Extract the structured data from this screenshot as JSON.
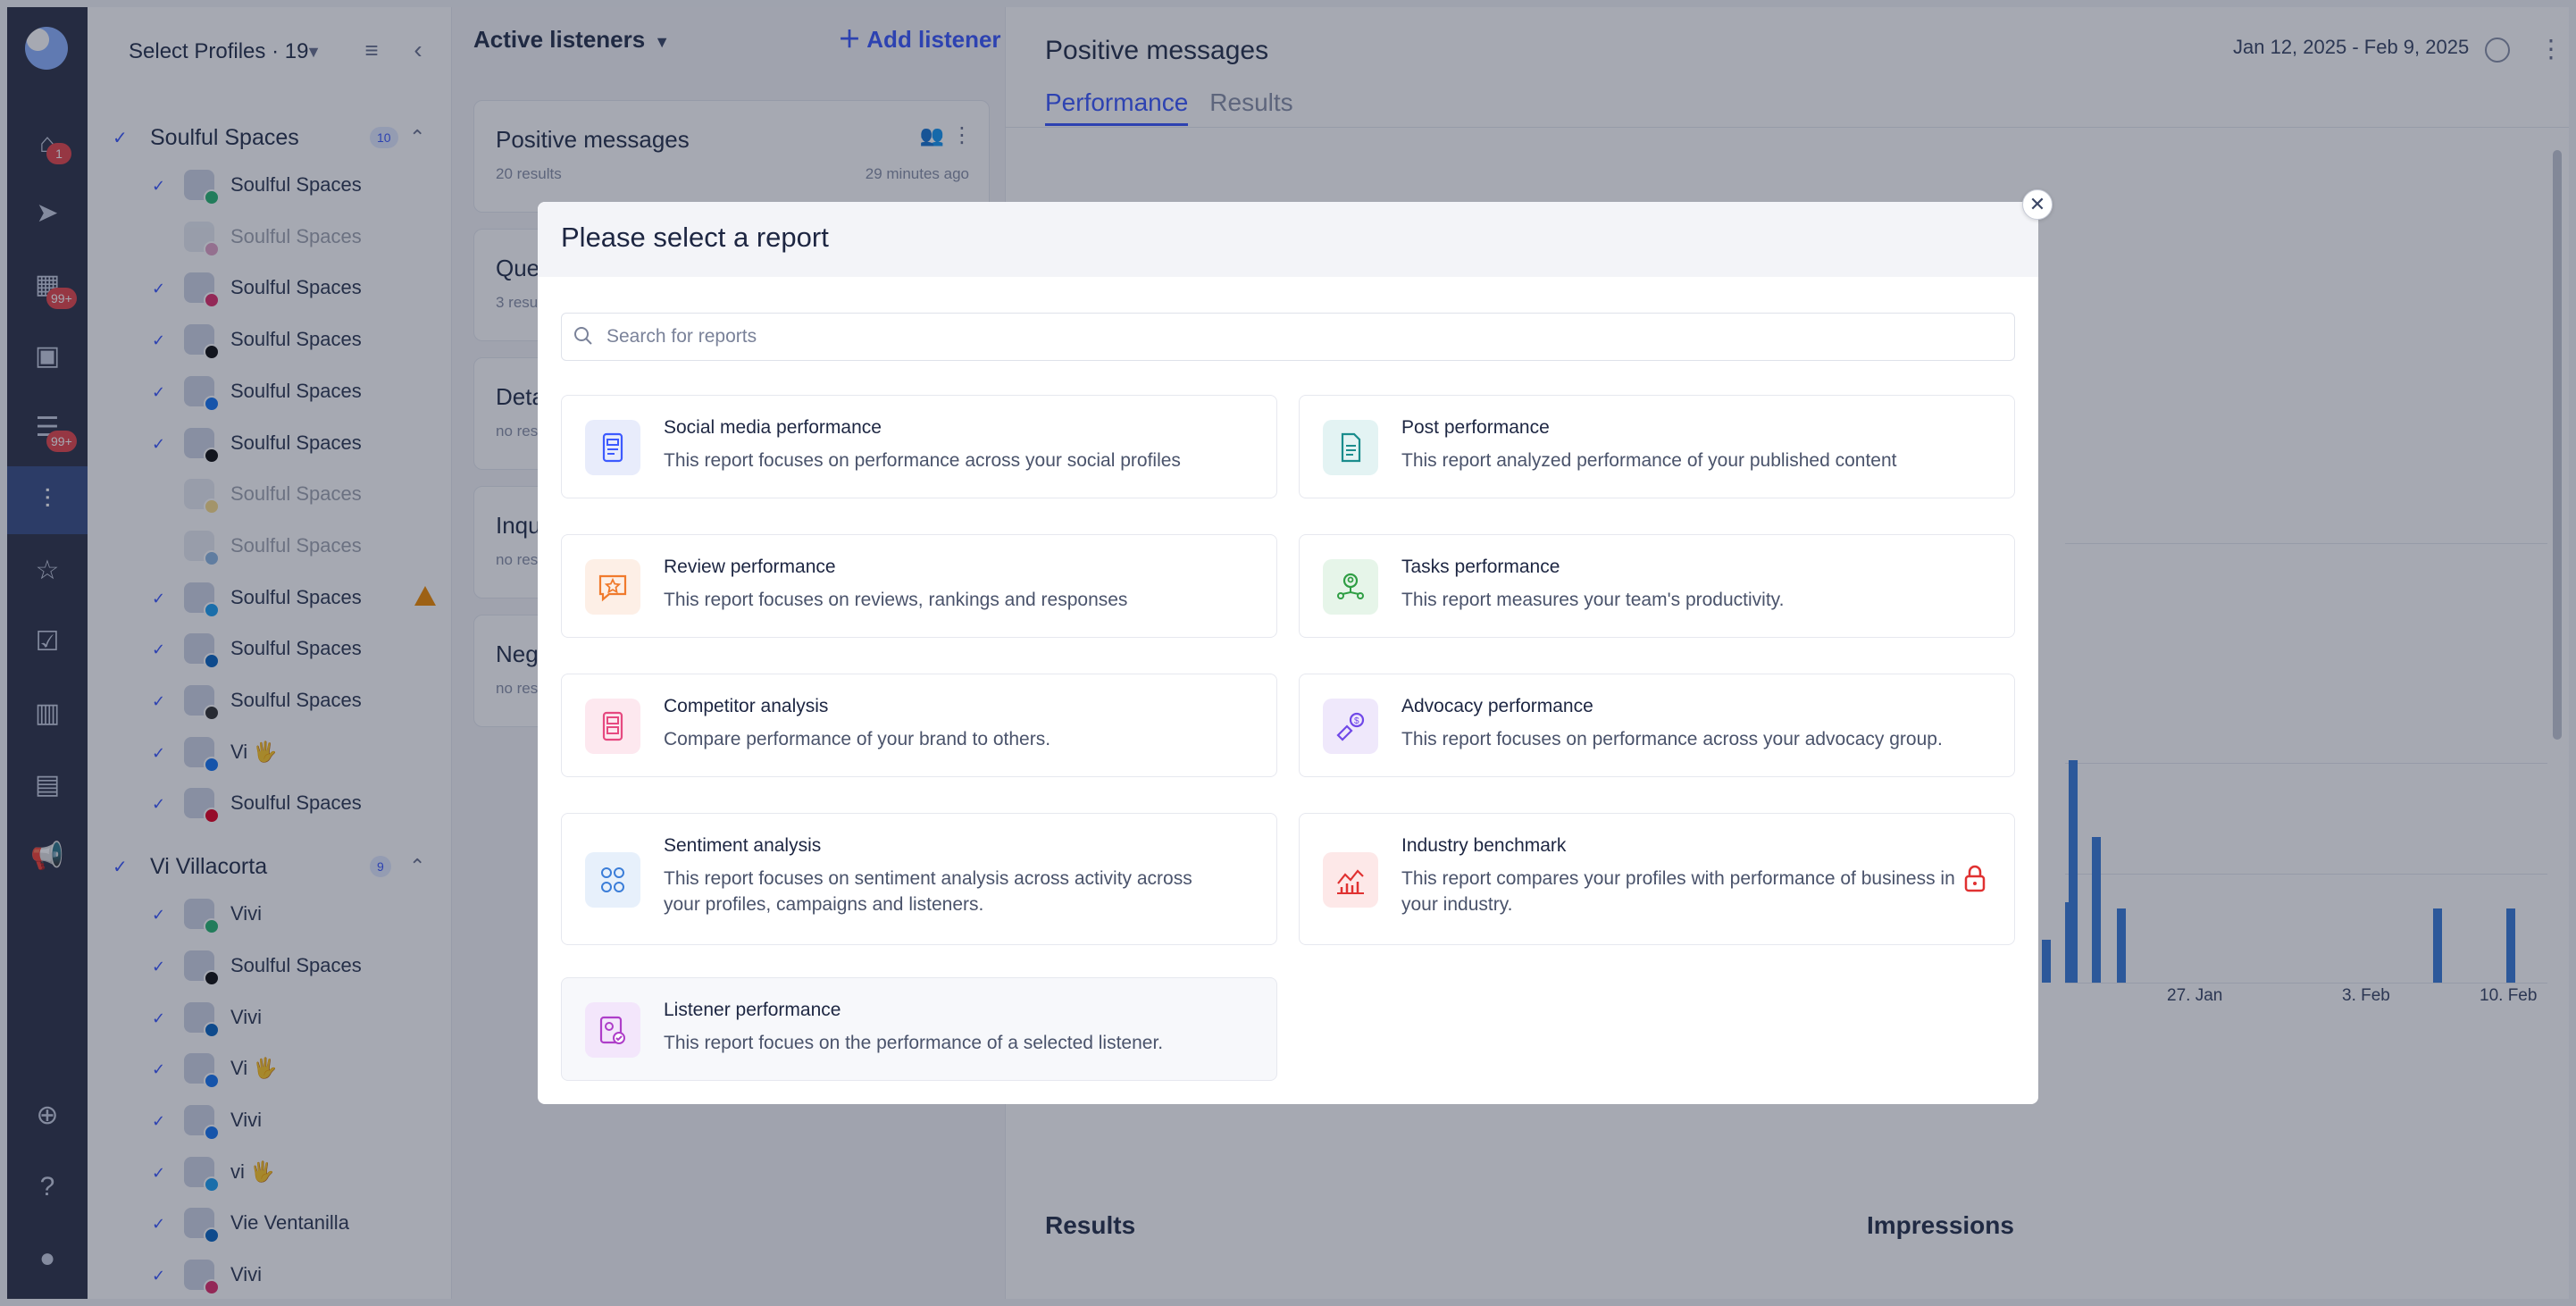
{
  "profiles_panel": {
    "select_label": "Select Profiles · 19",
    "groups": [
      {
        "name": "Soulful Spaces",
        "count": "10",
        "items": [
          {
            "name": "Soulful Spaces",
            "checked": true,
            "dim": false,
            "net_color": "#2bb673"
          },
          {
            "name": "Soulful Spaces",
            "checked": false,
            "dim": true,
            "net_color": "#c13584"
          },
          {
            "name": "Soulful Spaces",
            "checked": true,
            "dim": false,
            "net_color": "#e1306c"
          },
          {
            "name": "Soulful Spaces",
            "checked": true,
            "dim": false,
            "net_color": "#111111"
          },
          {
            "name": "Soulful Spaces",
            "checked": true,
            "dim": false,
            "net_color": "#1877f2"
          },
          {
            "name": "Soulful Spaces",
            "checked": true,
            "dim": false,
            "net_color": "#111111"
          },
          {
            "name": "Soulful Spaces",
            "checked": false,
            "dim": true,
            "net_color": "#f5b800"
          },
          {
            "name": "Soulful Spaces",
            "checked": false,
            "dim": true,
            "net_color": "#0a66c2"
          },
          {
            "name": "Soulful Spaces",
            "checked": true,
            "dim": false,
            "net_color": "#1da1f2",
            "warning": true
          },
          {
            "name": "Soulful Spaces",
            "checked": true,
            "dim": false,
            "net_color": "#0a66c2"
          },
          {
            "name": "Soulful Spaces",
            "checked": true,
            "dim": false,
            "net_color": "#333333"
          },
          {
            "name": "Vi 🖐",
            "checked": true,
            "dim": false,
            "net_color": "#1877f2"
          },
          {
            "name": "Soulful Spaces",
            "checked": true,
            "dim": false,
            "net_color": "#e60023"
          }
        ]
      },
      {
        "name": "Vi Villacorta",
        "count": "9",
        "items": [
          {
            "name": "Vivi",
            "checked": true,
            "dim": false,
            "net_color": "#2bb673"
          },
          {
            "name": "Soulful Spaces",
            "checked": true,
            "dim": false,
            "net_color": "#111111"
          },
          {
            "name": "Vivi",
            "checked": true,
            "dim": false,
            "net_color": "#0a66c2"
          },
          {
            "name": "Vi 🖐",
            "checked": true,
            "dim": false,
            "net_color": "#1877f2"
          },
          {
            "name": "Vivi",
            "checked": true,
            "dim": false,
            "net_color": "#1877f2"
          },
          {
            "name": "vi 🖐",
            "checked": true,
            "dim": false,
            "net_color": "#1da1f2"
          },
          {
            "name": "Vie Ventanilla",
            "checked": true,
            "dim": false,
            "net_color": "#0a66c2"
          },
          {
            "name": "Vivi",
            "checked": true,
            "dim": false,
            "net_color": "#e1306c"
          }
        ]
      }
    ]
  },
  "listeners_panel": {
    "header": "Active listeners",
    "add_label": "Add listener",
    "cards": [
      {
        "title": "Positive messages",
        "subtitle": "20 results",
        "time": "29 minutes ago"
      },
      {
        "title": "Quer",
        "subtitle": "3 resu",
        "time": ""
      },
      {
        "title": "Deta",
        "subtitle": "no resu",
        "time": ""
      },
      {
        "title": "Inqu",
        "subtitle": "no resu",
        "time": ""
      },
      {
        "title": "Nega",
        "subtitle": "no resu",
        "time": ""
      }
    ]
  },
  "main": {
    "title": "Positive messages",
    "date_range": "Jan 12, 2025 - Feb 9, 2025",
    "tabs": [
      "Performance",
      "Results"
    ],
    "active_tab": "Performance",
    "x_ticks": [
      "27. Jan",
      "3. Feb",
      "10. Feb"
    ],
    "sections": [
      "Results",
      "Impressions"
    ],
    "bars": [
      0.14,
      0.26,
      0.72,
      0.47,
      0.24,
      0.24,
      0.24
    ]
  },
  "modal": {
    "title": "Please select a report",
    "search_placeholder": "Search for reports",
    "reports": [
      {
        "title": "Social media performance",
        "desc": "This report focuses on performance across your social profiles",
        "icon": "social-media-icon",
        "icon_bg": "#e8ecfb",
        "icon_color": "#3d5afe",
        "locked": false
      },
      {
        "title": "Post performance",
        "desc": "This report analyzed performance of your published content",
        "icon": "document-icon",
        "icon_bg": "#e3f3f3",
        "icon_color": "#1a8c8c",
        "locked": false
      },
      {
        "title": "Review performance",
        "desc": "This report focuses on reviews, rankings and responses",
        "icon": "review-star-icon",
        "icon_bg": "#fdefe6",
        "icon_color": "#f07a2c",
        "locked": false
      },
      {
        "title": "Tasks performance",
        "desc": "This report measures your team's productivity.",
        "icon": "team-icon",
        "icon_bg": "#e6f5e9",
        "icon_color": "#2f9e44",
        "locked": false
      },
      {
        "title": "Competitor analysis",
        "desc": "Compare performance of your brand to others.",
        "icon": "competitor-icon",
        "icon_bg": "#fde8ef",
        "icon_color": "#e64980",
        "locked": false
      },
      {
        "title": "Advocacy performance",
        "desc": "This report focuses on performance across your advocacy group.",
        "icon": "advocacy-icon",
        "icon_bg": "#efe8fb",
        "icon_color": "#7048e8",
        "locked": false
      },
      {
        "title": "Sentiment analysis",
        "desc": "This report focuses on sentiment analysis across activity across your profiles, campaigns and listeners.",
        "icon": "sentiment-icon",
        "icon_bg": "#e7f0fb",
        "icon_color": "#3b7dd8",
        "locked": false
      },
      {
        "title": "Industry benchmark",
        "desc": "This report compares your profiles with performance of business in your industry.",
        "icon": "benchmark-chart-icon",
        "icon_bg": "#fde8e8",
        "icon_color": "#e03131",
        "locked": true
      },
      {
        "title": "Listener performance",
        "desc": "This report focues on the performance of a selected listener.",
        "icon": "listener-icon",
        "icon_bg": "#f3e6fb",
        "icon_color": "#ae3ec9",
        "locked": false
      }
    ]
  }
}
